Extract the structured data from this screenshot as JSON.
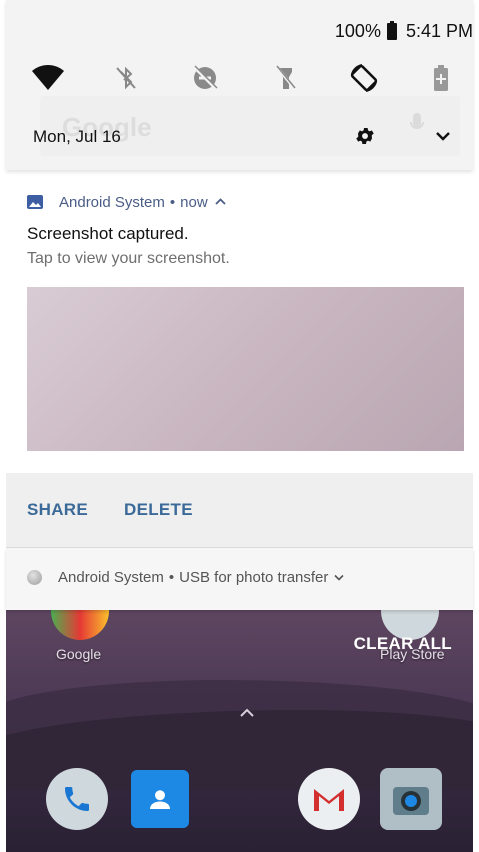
{
  "status_bar": {
    "battery": "100%",
    "time": "5:41 PM"
  },
  "quick_settings": {
    "date": "Mon, Jul 16",
    "ghost_search_text": "Google"
  },
  "notifications": [
    {
      "app": "Android System",
      "time": "now",
      "title": "Screenshot captured.",
      "text": "Tap to view your screenshot.",
      "actions": [
        "SHARE",
        "DELETE"
      ]
    },
    {
      "app": "Android System",
      "detail": "USB for photo transfer"
    }
  ],
  "home": {
    "clear_all": "CLEAR ALL",
    "app_labels": [
      "Google",
      "Play Store"
    ]
  },
  "colors": {
    "accent": "#3b6a99",
    "app_name": "#4a5d87",
    "wallpaper": "#4a3753"
  }
}
